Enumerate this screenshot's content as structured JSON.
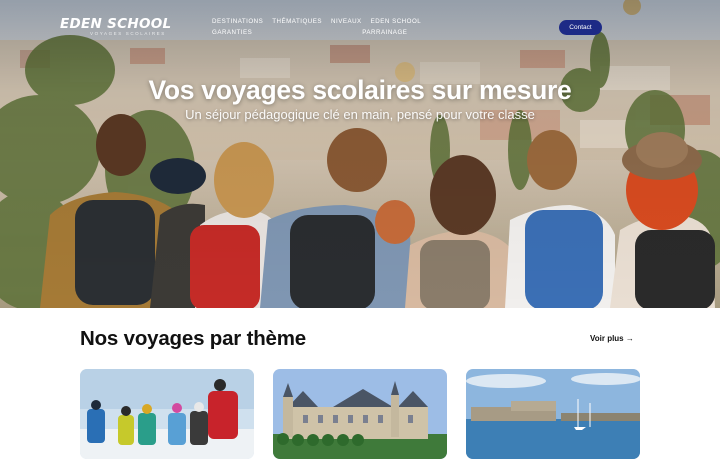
{
  "header": {
    "logo_text": "EDEN SCHOOL",
    "logo_tagline": "VOYAGES SCOLAIRES",
    "nav": [
      "DESTINATIONS",
      "THÉMATIQUES",
      "NIVEAUX",
      "EDEN SCHOOL",
      "GARANTIES",
      "PARRAINAGE"
    ],
    "contact_label": "Contact"
  },
  "hero": {
    "title": "Vos voyages scolaires sur mesure",
    "subtitle": "Un séjour pédagogique clé en main, pensé pour votre classe"
  },
  "themes": {
    "title": "Nos voyages par thème",
    "more_label": "Voir plus →"
  },
  "colors": {
    "accent": "#1d2a86",
    "text": "#111111"
  }
}
